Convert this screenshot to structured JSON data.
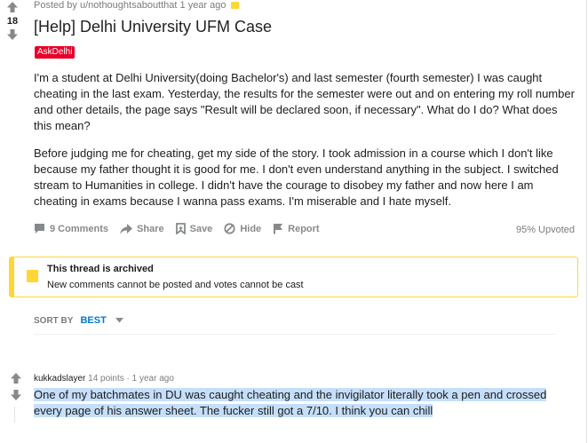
{
  "post": {
    "score": "18",
    "meta": "Posted by u/nothoughtsaboutthat 1 year ago",
    "title": "[Help] Delhi University UFM Case",
    "flair": "AskDelhi",
    "paragraphs": [
      "I'm a student at Delhi University(doing Bachelor's) and last semester (fourth semester) I was caught cheating in the last exam. Yesterday, the results for the semester were out and on entering my roll number and other details, the page says \"Result will be declared soon, if necessary\". What do I do? What does this mean?",
      "Before judging me for cheating, get my side of the story. I took admission in a course which I don't like because my father thought it is good for me. I don't even understand anything in the subject. I switched stream to Humanities in college. I didn't have the courage to disobey my father and now here I am cheating in exams because I wanna pass exams. I'm miserable and I hate myself."
    ],
    "actions": {
      "comments": "9 Comments",
      "share": "Share",
      "save": "Save",
      "hide": "Hide",
      "report": "Report"
    },
    "upvoted": "95% Upvoted"
  },
  "archived": {
    "title": "This thread is archived",
    "subtitle": "New comments cannot be posted and votes cannot be cast"
  },
  "sort": {
    "label": "SORT BY",
    "value": "BEST"
  },
  "comment": {
    "author": "kukkadslayer",
    "points": "14 points",
    "separator": "·",
    "time": "1 year ago",
    "body": "One of my batchmates in DU was caught cheating and the invigilator literally took a pen and crossed every page of his answer sheet. The fucker still got a 7/10. I think you can chill"
  },
  "colors": {
    "upvote": "#878a8c",
    "flair": "#ea0027",
    "archive": "#ffd635",
    "sort_accent": "#0079d3",
    "highlight": "#c5dffa"
  }
}
